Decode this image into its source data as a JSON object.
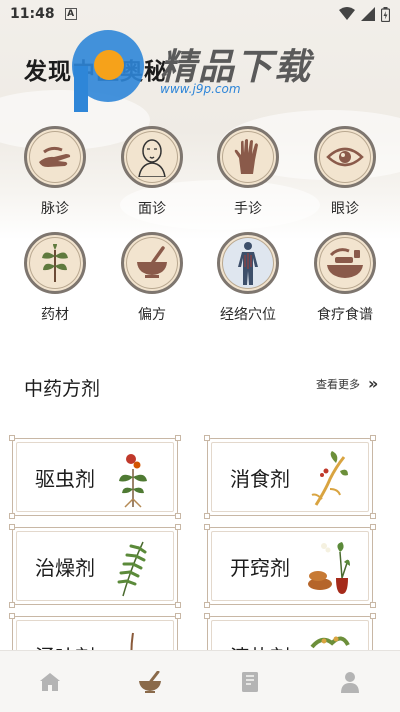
{
  "status_bar": {
    "time": "11:48",
    "notification_glyph": "A"
  },
  "header": {
    "title": "发现中医奥秘"
  },
  "watermark": {
    "brand": "精品下载",
    "url": "www.j9p.com"
  },
  "categories": [
    {
      "label": "脉诊",
      "icon": "pulse-diagnosis-icon"
    },
    {
      "label": "面诊",
      "icon": "face-diagnosis-icon"
    },
    {
      "label": "手诊",
      "icon": "hand-diagnosis-icon"
    },
    {
      "label": "眼诊",
      "icon": "eye-diagnosis-icon"
    },
    {
      "label": "药材",
      "icon": "herb-leaf-icon"
    },
    {
      "label": "偏方",
      "icon": "mortar-bowl-icon"
    },
    {
      "label": "经络穴位",
      "icon": "meridian-body-icon"
    },
    {
      "label": "食疗食谱",
      "icon": "food-therapy-icon"
    }
  ],
  "formula_section": {
    "title": "中药方剂",
    "see_more": "查看更多"
  },
  "formulas": [
    {
      "label": "驱虫剂"
    },
    {
      "label": "消食剂"
    },
    {
      "label": "治燥剂"
    },
    {
      "label": "开窍剂"
    },
    {
      "label": "涌吐剂"
    },
    {
      "label": "清热剂"
    }
  ],
  "bottom_nav": [
    {
      "name": "home",
      "icon": "home-icon",
      "active": false
    },
    {
      "name": "mortar",
      "icon": "mortar-icon",
      "active": true
    },
    {
      "name": "book",
      "icon": "book-icon",
      "active": false
    },
    {
      "name": "profile",
      "icon": "user-icon",
      "active": false
    }
  ],
  "colors": {
    "icon_ring": "#7e766f",
    "icon_fill": "#f2e4cf",
    "icon_glyph": "#8a5a4a",
    "card_border": "#c8b7a5",
    "nav_active": "#8a6a4a",
    "nav_inactive": "#b4b4b4"
  }
}
